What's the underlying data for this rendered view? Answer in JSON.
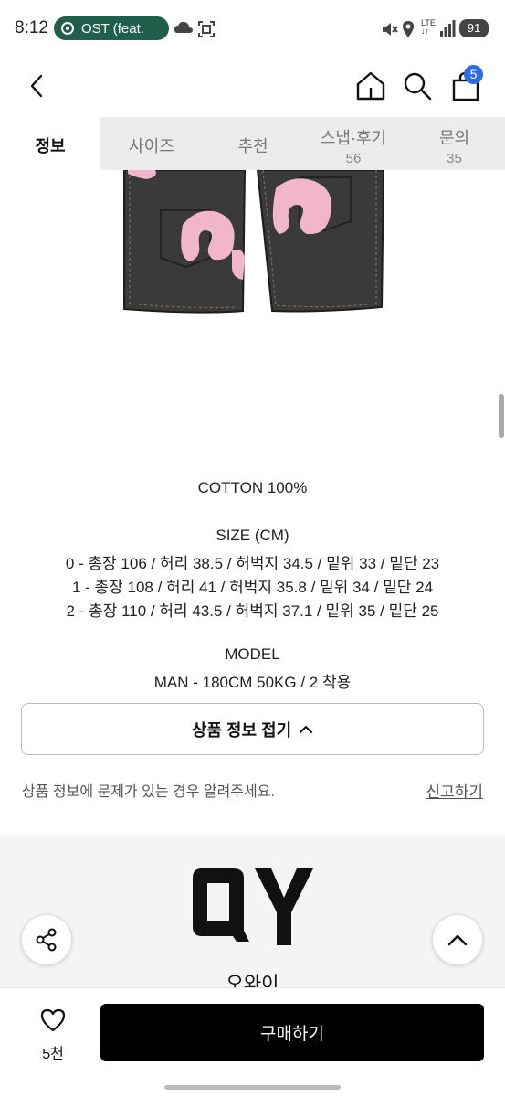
{
  "status_bar": {
    "time": "8:12",
    "media": "OST (feat.",
    "network": "LTE",
    "battery": "91"
  },
  "header": {
    "back_icon": "chevron-left-icon",
    "home_icon": "home-icon",
    "search_icon": "search-icon",
    "cart_icon": "shopping-bag-icon",
    "cart_count": "5"
  },
  "tabs": [
    {
      "label": "정보",
      "count": ""
    },
    {
      "label": "사이즈",
      "count": ""
    },
    {
      "label": "추천",
      "count": ""
    },
    {
      "label": "스냅·후기",
      "count": "56"
    },
    {
      "label": "문의",
      "count": "35"
    }
  ],
  "description": {
    "material": "COTTON 100%",
    "size_title": "SIZE (CM)",
    "sizes": [
      "0 - 총장 106 / 허리 38.5 / 허벅지 34.5 / 밑위 33 / 밑단 23",
      "1 - 총장 108 / 허리 41 / 허벅지 35.8 / 밑위 34 / 밑단 24",
      "2 - 총장 110 / 허리 43.5 / 허벅지 37.1 / 밑위 35 / 밑단 25"
    ],
    "model_title": "MODEL",
    "model_info": "MAN - 180CM 50KG / 2 착용"
  },
  "collapse_button": "상품 정보 접기",
  "report": {
    "text": "상품 정보에 문제가 있는 경우 알려주세요.",
    "link": "신고하기"
  },
  "brand": {
    "logo": "QY",
    "name": "오와이"
  },
  "bottom_bar": {
    "like_icon": "heart-icon",
    "like_count": "5천",
    "buy_label": "구매하기"
  },
  "colors": {
    "accent_badge": "#2d6be4",
    "buy_button": "#000000",
    "media_pill": "#1f5f4c",
    "denim": "#3a3a3a",
    "print_pink": "#f1b6cc"
  }
}
